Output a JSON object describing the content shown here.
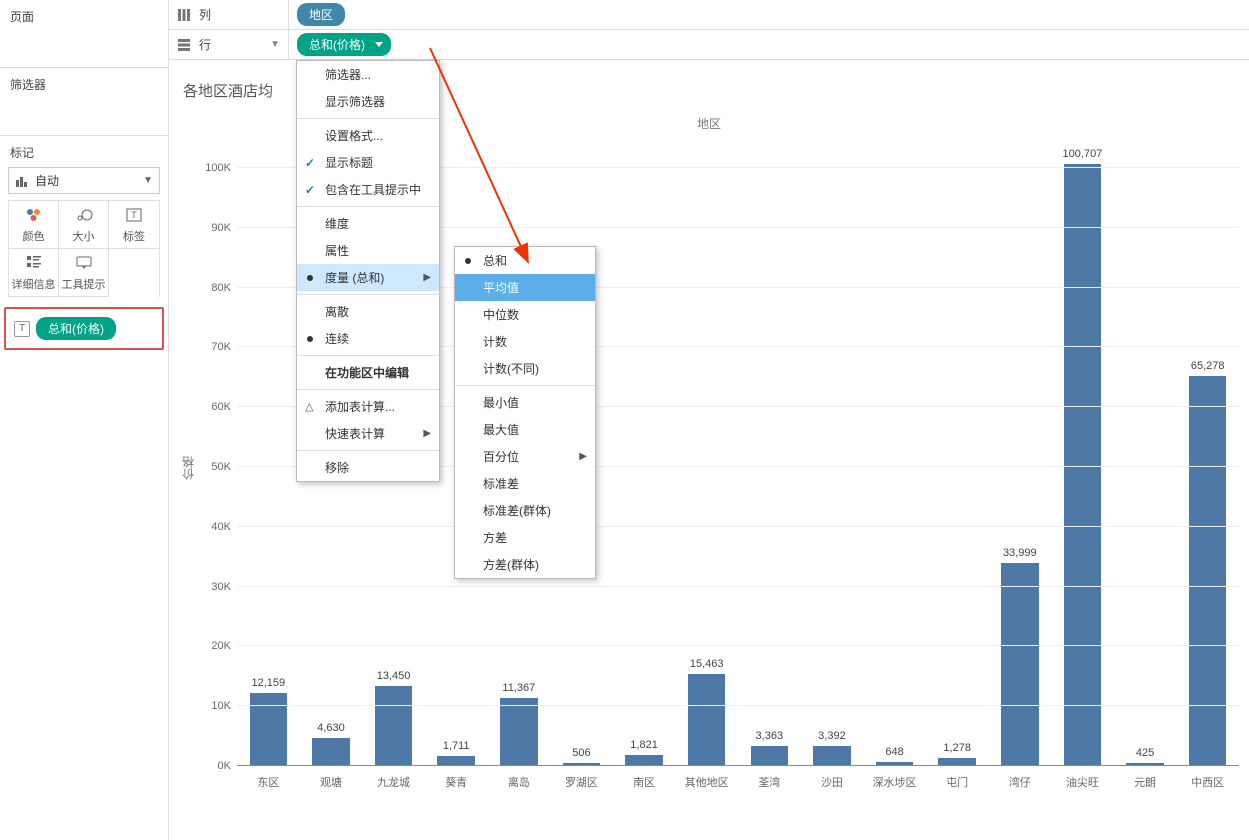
{
  "sidebar": {
    "pages_label": "页面",
    "filters_label": "筛选器",
    "marks_label": "标记",
    "marks_dropdown": "自动",
    "cells": [
      "颜色",
      "大小",
      "标签",
      "详细信息",
      "工具提示",
      ""
    ],
    "pill_label": "总和(价格)"
  },
  "shelves": {
    "columns_label": "列",
    "rows_label": "行",
    "columns_pill": "地区",
    "rows_pill": "总和(价格)"
  },
  "chart_title": "各地区酒店均",
  "axis_top": "地区",
  "yaxis_label": "价格",
  "menu1": {
    "items": [
      {
        "label": "筛选器...",
        "type": "plain"
      },
      {
        "label": "显示筛选器",
        "type": "plain"
      },
      {
        "type": "sep"
      },
      {
        "label": "设置格式...",
        "type": "plain"
      },
      {
        "label": "显示标题",
        "type": "check"
      },
      {
        "label": "包含在工具提示中",
        "type": "check"
      },
      {
        "type": "sep"
      },
      {
        "label": "维度",
        "type": "plain"
      },
      {
        "label": "属性",
        "type": "plain"
      },
      {
        "label": "度量 (总和)",
        "type": "bullet-sub",
        "highlight": true
      },
      {
        "type": "sep"
      },
      {
        "label": "离散",
        "type": "plain"
      },
      {
        "label": "连续",
        "type": "bullet"
      },
      {
        "type": "sep"
      },
      {
        "label": "在功能区中编辑",
        "type": "bold"
      },
      {
        "type": "sep"
      },
      {
        "label": "添加表计算...",
        "type": "delta"
      },
      {
        "label": "快速表计算",
        "type": "sub"
      },
      {
        "type": "sep"
      },
      {
        "label": "移除",
        "type": "plain"
      }
    ]
  },
  "menu2": {
    "items": [
      {
        "label": "总和",
        "type": "bullet"
      },
      {
        "label": "平均值",
        "type": "selected"
      },
      {
        "label": "中位数",
        "type": "plain"
      },
      {
        "label": "计数",
        "type": "plain"
      },
      {
        "label": "计数(不同)",
        "type": "plain"
      },
      {
        "type": "sep"
      },
      {
        "label": "最小值",
        "type": "plain"
      },
      {
        "label": "最大值",
        "type": "plain"
      },
      {
        "label": "百分位",
        "type": "sub"
      },
      {
        "label": "标准差",
        "type": "plain"
      },
      {
        "label": "标准差(群体)",
        "type": "plain"
      },
      {
        "label": "方差",
        "type": "plain"
      },
      {
        "label": "方差(群体)",
        "type": "plain"
      }
    ]
  },
  "chart_data": {
    "type": "bar",
    "title": "各地区酒店均",
    "xlabel": "地区",
    "ylabel": "价格",
    "ylim": [
      0,
      105000
    ],
    "yticks": [
      0,
      10000,
      20000,
      30000,
      40000,
      50000,
      60000,
      70000,
      80000,
      90000,
      100000
    ],
    "ytick_labels": [
      "0K",
      "10K",
      "20K",
      "30K",
      "40K",
      "50K",
      "60K",
      "70K",
      "80K",
      "90K",
      "100K"
    ],
    "categories": [
      "东区",
      "观塘",
      "九龙城",
      "葵青",
      "离岛",
      "罗湖区",
      "南区",
      "其他地区",
      "荃湾",
      "沙田",
      "深水埗区",
      "屯门",
      "湾仔",
      "油尖旺",
      "元朗",
      "中西区"
    ],
    "values": [
      12159,
      4630,
      13450,
      1711,
      11367,
      506,
      1821,
      15463,
      3363,
      3392,
      648,
      1278,
      33999,
      100707,
      425,
      65278
    ],
    "value_labels": [
      "12,159",
      "4,630",
      "13,450",
      "1,711",
      "11,367",
      "506",
      "1,821",
      "15,463",
      "3,363",
      "3,392",
      "648",
      "1,278",
      "33,999",
      "100,707",
      "425",
      "65,278"
    ]
  }
}
